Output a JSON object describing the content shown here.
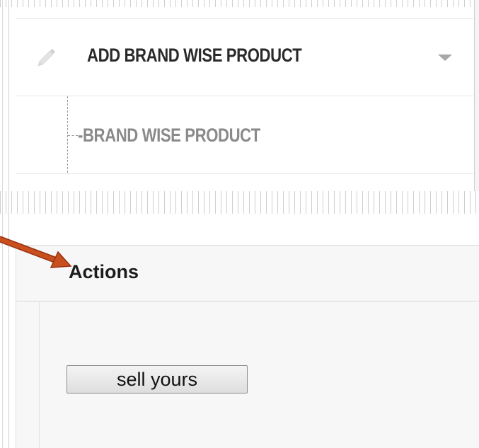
{
  "menu": {
    "add_item_label": "ADD BRAND WISE PRODUCT",
    "sub_item_label": "-BRAND WISE PRODUCT"
  },
  "actions": {
    "title": "Actions",
    "sell_button_label": "sell yours"
  },
  "colors": {
    "arrow": "#c0461c",
    "menu_text": "#2a2a2a",
    "submenu_text": "#8a8a8a"
  },
  "icons": {
    "edit": "pencil-icon",
    "dropdown": "chevron-down-icon",
    "annotation": "arrow-annotation-icon"
  }
}
